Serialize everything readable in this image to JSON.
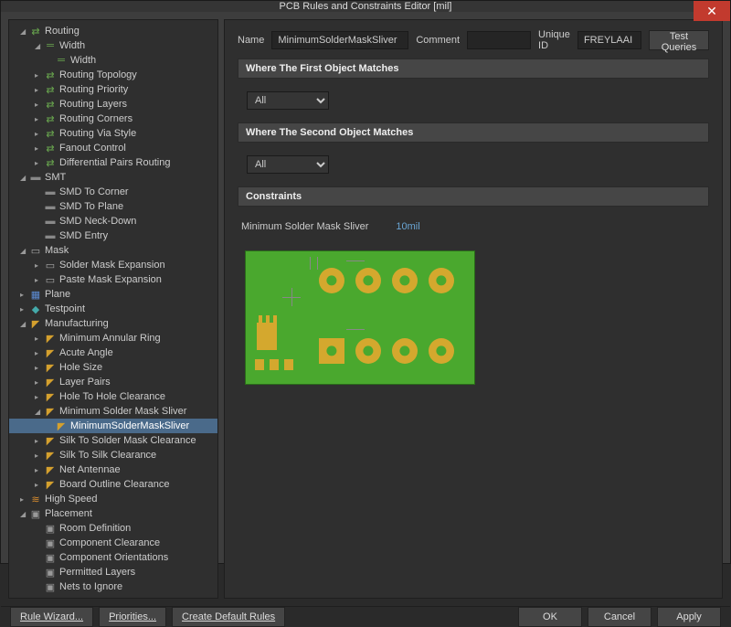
{
  "window": {
    "title": "PCB Rules and Constraints Editor [mil]"
  },
  "tree": {
    "routing": "Routing",
    "width_cat": "Width",
    "width_rule": "Width",
    "routing_topology": "Routing Topology",
    "routing_priority": "Routing Priority",
    "routing_layers": "Routing Layers",
    "routing_corners": "Routing Corners",
    "routing_via": "Routing Via Style",
    "fanout": "Fanout Control",
    "diff_pairs": "Differential Pairs Routing",
    "smt": "SMT",
    "smd_corner": "SMD To Corner",
    "smd_plane": "SMD To Plane",
    "smd_neck": "SMD Neck-Down",
    "smd_entry": "SMD Entry",
    "mask": "Mask",
    "solder_mask_exp": "Solder Mask Expansion",
    "paste_mask_exp": "Paste Mask Expansion",
    "plane": "Plane",
    "testpoint": "Testpoint",
    "manufacturing": "Manufacturing",
    "min_annular": "Minimum Annular Ring",
    "acute_angle": "Acute Angle",
    "hole_size": "Hole Size",
    "layer_pairs": "Layer Pairs",
    "hole_to_hole": "Hole To Hole Clearance",
    "min_sliver": "Minimum Solder Mask Sliver",
    "min_sliver_rule": "MinimumSolderMaskSliver",
    "silk_solder": "Silk To Solder Mask Clearance",
    "silk_silk": "Silk To Silk Clearance",
    "net_antennae": "Net Antennae",
    "board_outline": "Board Outline Clearance",
    "high_speed": "High Speed",
    "placement": "Placement",
    "room_def": "Room Definition",
    "comp_clear": "Component Clearance",
    "comp_orient": "Component Orientations",
    "perm_layers": "Permitted Layers",
    "nets_ignore": "Nets to Ignore"
  },
  "form": {
    "name_label": "Name",
    "name_value": "MinimumSolderMaskSliver",
    "comment_label": "Comment",
    "comment_value": "",
    "uid_label": "Unique ID",
    "uid_value": "FREYLAAI",
    "test_queries": "Test Queries"
  },
  "sections": {
    "first_match": "Where The First Object Matches",
    "second_match": "Where The Second Object Matches",
    "constraints": "Constraints",
    "scope_all": "All"
  },
  "constraint": {
    "label": "Minimum Solder Mask Sliver",
    "value": "10mil"
  },
  "footer": {
    "rule_wizard": "Rule Wizard...",
    "priorities": "Priorities...",
    "create_default": "Create Default Rules",
    "ok": "OK",
    "cancel": "Cancel",
    "apply": "Apply"
  }
}
